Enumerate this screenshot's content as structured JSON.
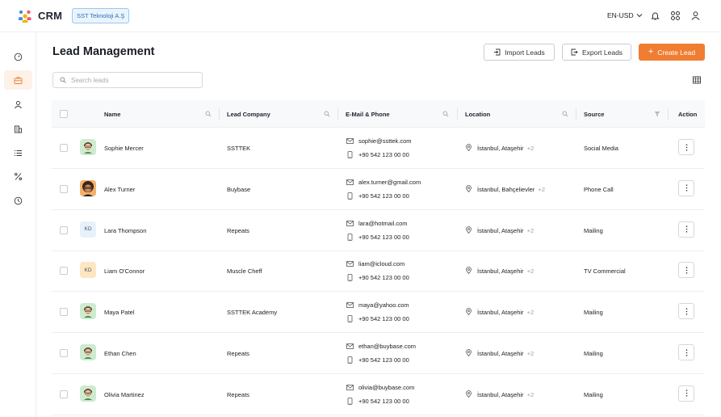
{
  "app": {
    "title": "CRM",
    "company": "SST Teknoloji A.Ş"
  },
  "topbar": {
    "currency": "EN-USD",
    "icons": [
      "bell-icon",
      "apps-icon",
      "user-icon"
    ]
  },
  "sidebar": {
    "items": [
      "dashboard-icon",
      "briefcase-icon",
      "user-icon",
      "building-icon",
      "list-icon",
      "percent-icon",
      "history-icon"
    ],
    "active_index": 1
  },
  "page": {
    "title": "Lead Management",
    "import_label": "Import Leads",
    "export_label": "Export Leads",
    "create_label": "Create Lead",
    "search_placeholder": "Search leads"
  },
  "table": {
    "columns": [
      "Name",
      "Lead Company",
      "E-Mail & Phone",
      "Location",
      "Source",
      "Action"
    ],
    "rows": [
      {
        "name": "Sophie Mercer",
        "avatar": "face",
        "avatar_bg": "#cdeccf",
        "company": "SSTTEK",
        "email": "sophie@ssttek.com",
        "phone": "+90 542 123 00 00",
        "location": "İstanbul, Ataşehir",
        "extra": "+2",
        "source": "Social Media"
      },
      {
        "name": "Alex Turner",
        "avatar": "face-dark",
        "avatar_bg": "#f3b26a",
        "company": "Buybase",
        "email": "alex.turner@gmail.com",
        "phone": "+90 542 123 00 00",
        "location": "İstanbul, Bahçelievler",
        "extra": "+2",
        "source": "Phone Call"
      },
      {
        "name": "Lara Thompson",
        "avatar": "KD",
        "avatar_bg": "#e6f1fb",
        "company": "Repeats",
        "email": "lara@hotmail.com",
        "phone": "+90 542 123 00 00",
        "location": "İstanbul, Ataşehir",
        "extra": "+2",
        "source": "Mailing"
      },
      {
        "name": "Liam O'Connor",
        "avatar": "KD",
        "avatar_bg": "#fde7c2",
        "company": "Muscle Cheff",
        "email": "liam@icloud.com",
        "phone": "+90 542 123 00 00",
        "location": "İstanbul, Ataşehir",
        "extra": "+2",
        "source": "TV Commercial"
      },
      {
        "name": "Maya Patel",
        "avatar": "face",
        "avatar_bg": "#cdeccf",
        "company": "SSTTEK Academy",
        "email": "maya@yahoo.com",
        "phone": "+90 542 123 00 00",
        "location": "İstanbul, Ataşehir",
        "extra": "+2",
        "source": "Mailing"
      },
      {
        "name": "Ethan Chen",
        "avatar": "face",
        "avatar_bg": "#cdeccf",
        "company": "Repeats",
        "email": "ethan@buybase.com",
        "phone": "+90 542 123 00 00",
        "location": "İstanbul, Ataşehir",
        "extra": "+2",
        "source": "Mailing"
      },
      {
        "name": "Olivia Martinez",
        "avatar": "face",
        "avatar_bg": "#cdeccf",
        "company": "Repeats",
        "email": "olivia@buybase.com",
        "phone": "+90 542 123 00 00",
        "location": "İstanbul, Ataşehir",
        "extra": "+2",
        "source": "Mailing"
      }
    ]
  },
  "colors": {
    "accent": "#ef7d32",
    "badge_border": "#9cc7ef",
    "badge_bg": "#eaf4fd"
  }
}
